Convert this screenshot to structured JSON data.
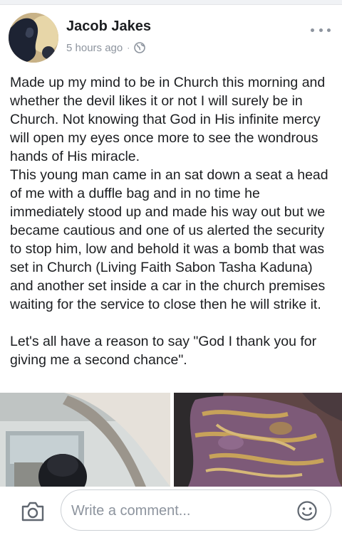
{
  "post": {
    "author": "Jacob Jakes",
    "timestamp": "5 hours ago",
    "separator": "·",
    "privacy_icon": "globe-icon",
    "menu_icon": "more-icon",
    "text": "Made up my mind to be in Church this morning and whether the devil likes it or not I will surely be in Church. Not knowing that God in His infinite mercy will open my eyes once more to see the wondrous hands of His miracle.\nThis young man came in an sat down a seat a head of me with a duffle bag and in no time he immediately stood up and made his way out but we became cautious and one of us alerted the security to stop him, low and behold it was a bomb that was set in Church (Living Faith Sabon Tasha Kaduna) and another set inside a car in the church premises waiting for the service to close then he will strike it.\n\nLet's all have a reason to say \"God I thank you for giving me a second chance\"."
  },
  "composer": {
    "placeholder": "Write a comment...",
    "camera_icon": "camera-icon",
    "emoji_icon": "emoji-icon"
  },
  "colors": {
    "text": "#1c1e21",
    "secondary": "#8d949e",
    "border": "#ccd0d5"
  }
}
